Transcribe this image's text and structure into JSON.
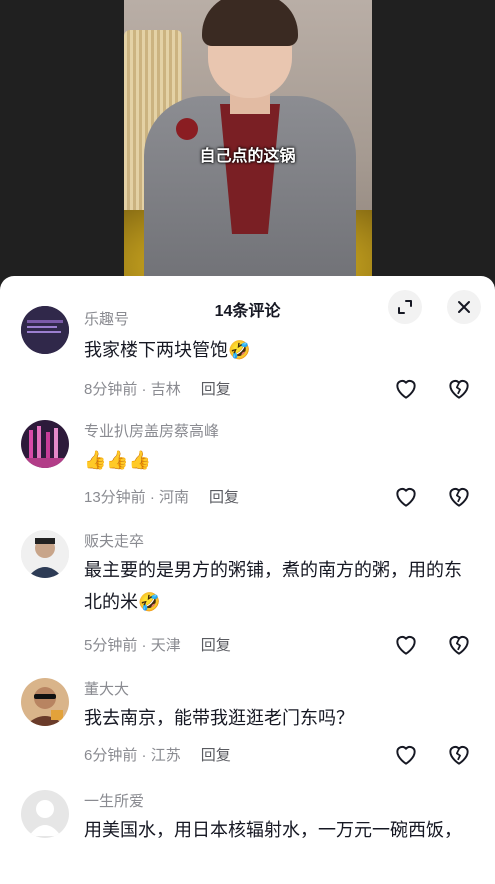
{
  "video": {
    "caption": "自己点的这锅"
  },
  "sheet": {
    "title": "14条评论"
  },
  "comments": [
    {
      "username": "乐趣号",
      "text": "我家楼下两块管饱",
      "emoji": "🤣",
      "time": "8分钟前",
      "location": "吉林",
      "reply": "回复"
    },
    {
      "username": "专业扒房盖房蔡高峰",
      "text": "",
      "emoji": "👍👍👍",
      "time": "13分钟前",
      "location": "河南",
      "reply": "回复"
    },
    {
      "username": "贩夫走卒",
      "text": "最主要的是男方的粥铺，煮的南方的粥，用的东北的米",
      "emoji": "🤣",
      "time": "5分钟前",
      "location": "天津",
      "reply": "回复"
    },
    {
      "username": "董大大",
      "text": "我去南京，能带我逛逛老门东吗？",
      "emoji": "",
      "time": "6分钟前",
      "location": "江苏",
      "reply": "回复"
    },
    {
      "username": "一生所爱",
      "text": "用美国水，用日本核辐射水，一万元一碗西饭，",
      "emoji": "",
      "time": "",
      "location": "",
      "reply": ""
    }
  ]
}
